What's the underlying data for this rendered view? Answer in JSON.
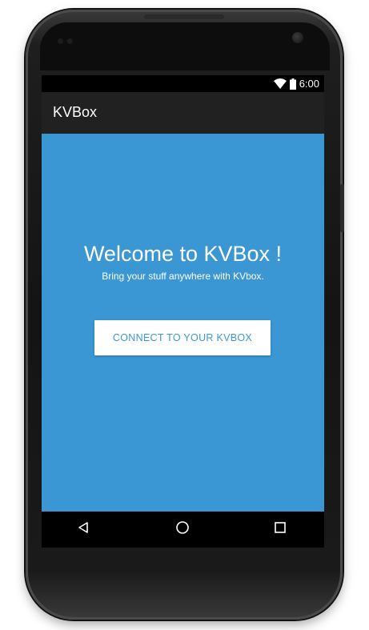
{
  "status_bar": {
    "time": "6:00",
    "wifi_icon": "wifi-icon",
    "battery_icon": "battery-icon"
  },
  "app_bar": {
    "title": "KVBox"
  },
  "main": {
    "welcome_title": "Welcome to KVBox !",
    "welcome_subtitle": "Bring your stuff anywhere with KVbox.",
    "connect_button_label": "CONNECT TO YOUR KVBOX"
  },
  "nav_bar": {
    "back_icon": "back-triangle-icon",
    "home_icon": "home-circle-icon",
    "recents_icon": "recents-square-icon"
  },
  "colors": {
    "content_background": "#3b97d3",
    "app_bar_background": "#212121",
    "button_text": "#3b97d3",
    "button_background": "#ffffff"
  }
}
